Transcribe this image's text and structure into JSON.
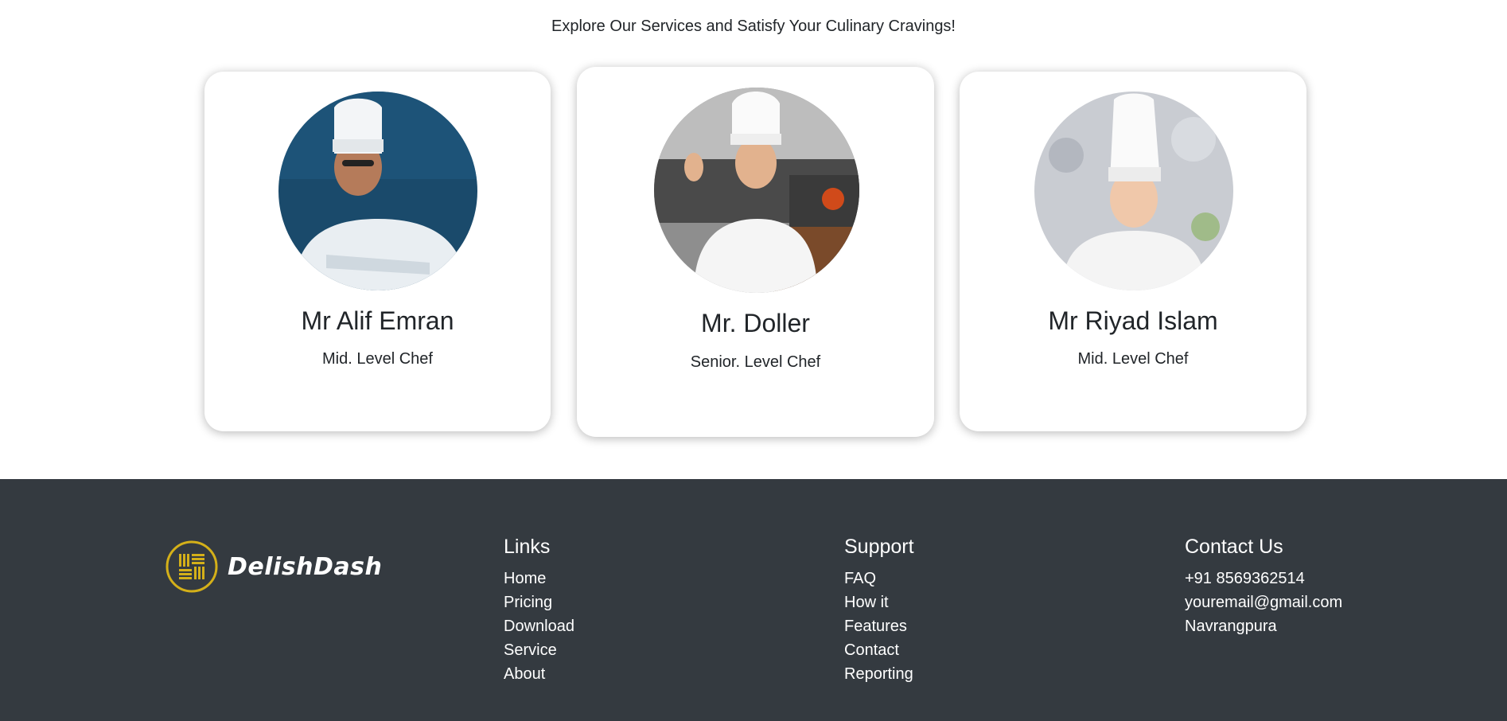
{
  "intro": "Explore Our Services and Satisfy Your Culinary Cravings!",
  "chefs": [
    {
      "name": "Mr Alif Emran",
      "role": "Mid. Level Chef"
    },
    {
      "name": "Mr. Doller",
      "role": "Senior. Level Chef"
    },
    {
      "name": "Mr Riyad Islam",
      "role": "Mid. Level Chef"
    }
  ],
  "footer": {
    "brand": "DelishDash",
    "links": {
      "title": "Links",
      "items": [
        "Home",
        "Pricing",
        "Download",
        "Service",
        "About"
      ]
    },
    "support": {
      "title": "Support",
      "items": [
        "FAQ",
        "How it",
        "Features",
        "Contact",
        "Reporting"
      ]
    },
    "contact": {
      "title": "Contact Us",
      "items": [
        "+91 8569362514",
        "youremail@gmail.com",
        "Navrangpura"
      ]
    }
  },
  "colors": {
    "footer_bg": "#343a40",
    "logo_gold": "#d4b019",
    "text": "#212529"
  }
}
